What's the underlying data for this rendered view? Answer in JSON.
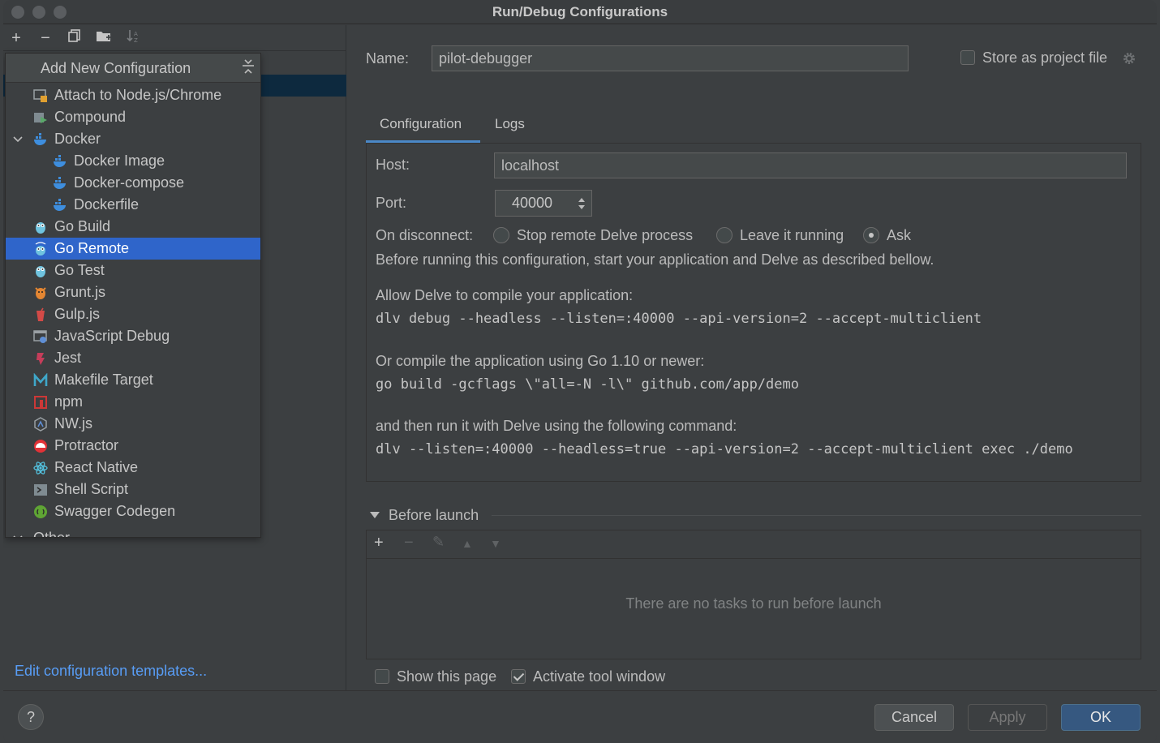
{
  "window": {
    "title": "Run/Debug Configurations"
  },
  "left_toolbar": {
    "add": "+",
    "remove": "−",
    "copy": "copy",
    "folder": "folder",
    "sort": "sort"
  },
  "popup": {
    "title": "Add New Configuration",
    "items": [
      {
        "label": "Attach to Node.js/Chrome",
        "icon": "nodejs-attach-icon"
      },
      {
        "label": "Compound",
        "icon": "compound-icon"
      },
      {
        "label": "Docker",
        "icon": "docker-icon"
      },
      {
        "label": "Docker Image",
        "icon": "docker-icon"
      },
      {
        "label": "Docker-compose",
        "icon": "docker-icon"
      },
      {
        "label": "Dockerfile",
        "icon": "docker-icon"
      },
      {
        "label": "Go Build",
        "icon": "gopher-icon"
      },
      {
        "label": "Go Remote",
        "icon": "gopher-remote-icon"
      },
      {
        "label": "Go Test",
        "icon": "gopher-icon"
      },
      {
        "label": "Grunt.js",
        "icon": "grunt-icon"
      },
      {
        "label": "Gulp.js",
        "icon": "gulp-icon"
      },
      {
        "label": "JavaScript Debug",
        "icon": "js-debug-icon"
      },
      {
        "label": "Jest",
        "icon": "jest-icon"
      },
      {
        "label": "Makefile Target",
        "icon": "makefile-icon"
      },
      {
        "label": "npm",
        "icon": "npm-icon"
      },
      {
        "label": "NW.js",
        "icon": "nwjs-icon"
      },
      {
        "label": "Protractor",
        "icon": "protractor-icon"
      },
      {
        "label": "React Native",
        "icon": "react-icon"
      },
      {
        "label": "Shell Script",
        "icon": "shell-icon"
      },
      {
        "label": "Swagger Codegen",
        "icon": "swagger-icon"
      },
      {
        "label": "Other",
        "icon": "chevron-down-icon"
      }
    ]
  },
  "edit_templates_link": "Edit configuration templates...",
  "name_field": {
    "label": "Name:",
    "value": "pilot-debugger"
  },
  "store_as_project": {
    "label": "Store as project file",
    "checked": false
  },
  "tabs": [
    {
      "label": "Configuration",
      "active": true
    },
    {
      "label": "Logs",
      "active": false
    }
  ],
  "config": {
    "host_label": "Host:",
    "host_value": "localhost",
    "port_label": "Port:",
    "port_value": "40000",
    "on_disconnect_label": "On disconnect:",
    "radio_options": [
      {
        "label": "Stop remote Delve process",
        "checked": false
      },
      {
        "label": "Leave it running",
        "checked": false
      },
      {
        "label": "Ask",
        "checked": true
      }
    ],
    "intro": "Before running this configuration, start your application and Delve as described bellow.",
    "step1_text": "Allow Delve to compile your application:",
    "step1_cmd": "dlv debug --headless --listen=:40000 --api-version=2 --accept-multiclient",
    "step2_text": "Or compile the application using Go 1.10 or newer:",
    "step2_cmd": "go build -gcflags \\\"all=-N -l\\\" github.com/app/demo",
    "step3_text": "and then run it with Delve using the following command:",
    "step3_cmd": "dlv --listen=:40000 --headless=true --api-version=2 --accept-multiclient exec ./demo"
  },
  "before_launch": {
    "title": "Before launch",
    "toolbar": {
      "add": "+",
      "remove": "−",
      "edit": "✎",
      "up": "▲",
      "down": "▼"
    },
    "empty_text": "There are no tasks to run before launch"
  },
  "options": {
    "show_page_label": "Show this page",
    "show_page_checked": false,
    "activate_tool_label": "Activate tool window",
    "activate_tool_checked": true
  },
  "buttons": {
    "help": "?",
    "cancel": "Cancel",
    "apply": "Apply",
    "ok": "OK"
  },
  "colors": {
    "background": "#3c3f41",
    "selection": "#2f65ca",
    "link": "#589df6",
    "tab_underline": "#4a88c7",
    "primary_button": "#365880"
  }
}
